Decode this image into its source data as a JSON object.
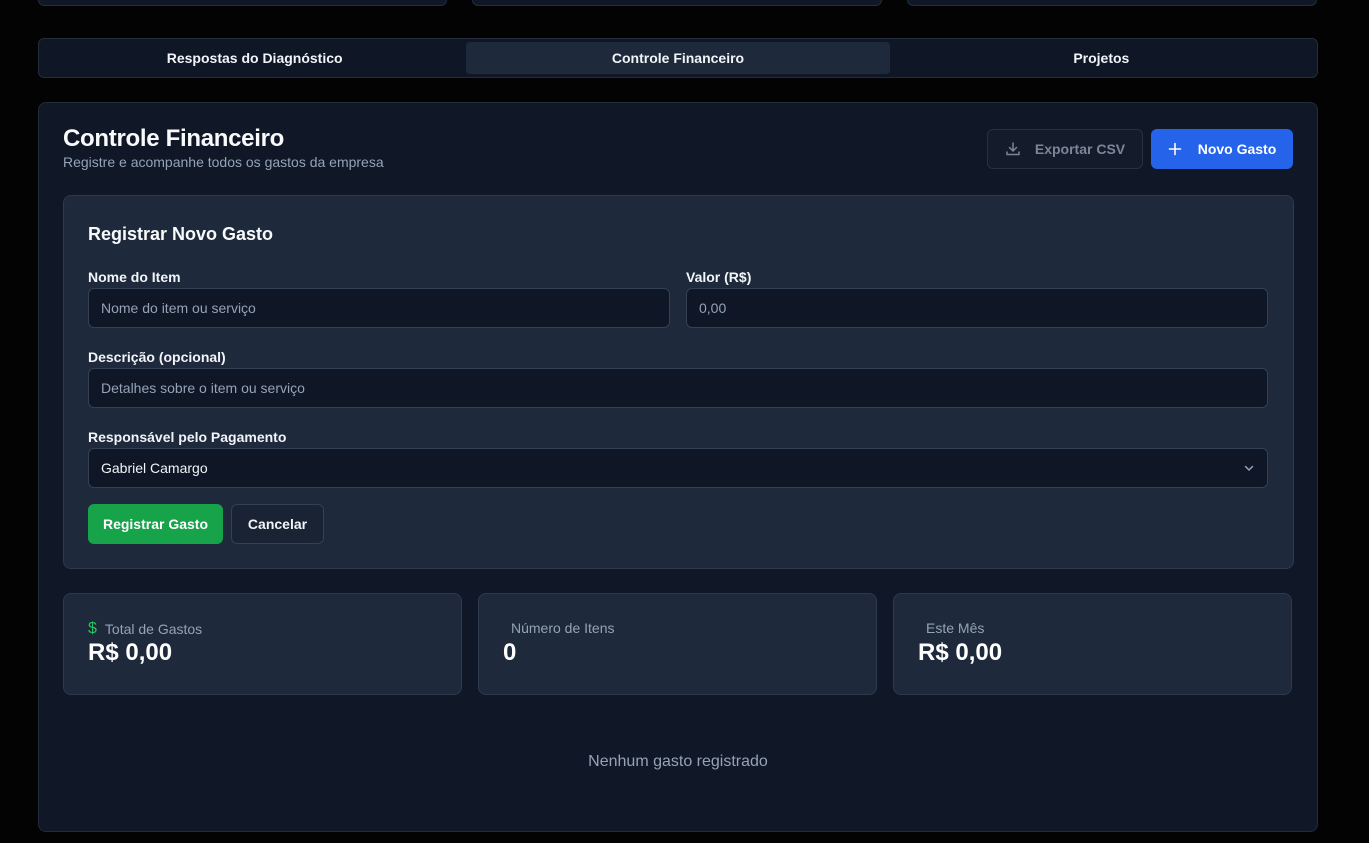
{
  "tabs": [
    {
      "label": "Respostas do Diagnóstico",
      "active": false
    },
    {
      "label": "Controle Financeiro",
      "active": true
    },
    {
      "label": "Projetos",
      "active": false
    }
  ],
  "header": {
    "title": "Controle Financeiro",
    "subtitle": "Registre e acompanhe todos os gastos da empresa",
    "export_label": "Exportar CSV",
    "export_icon": "download-icon",
    "new_label": "Novo Gasto",
    "new_icon": "plus-icon"
  },
  "form": {
    "title": "Registrar Novo Gasto",
    "name_label": "Nome do Item",
    "name_placeholder": "Nome do item ou serviço",
    "name_value": "",
    "value_label": "Valor (R$)",
    "value_placeholder": "0,00",
    "value_value": "",
    "desc_label": "Descrição (opcional)",
    "desc_placeholder": "Detalhes sobre o item ou serviço",
    "desc_value": "",
    "payer_label": "Responsável pelo Pagamento",
    "payer_selected": "Gabriel Camargo",
    "submit_label": "Registrar Gasto",
    "cancel_label": "Cancelar"
  },
  "stats": {
    "total_label": "Total de Gastos",
    "total_value": "R$ 0,00",
    "total_icon": "dollar-icon",
    "count_label": "Número de Itens",
    "count_value": "0",
    "month_label": "Este Mês",
    "month_value": "R$ 0,00"
  },
  "empty_message": "Nenhum gasto registrado",
  "colors": {
    "background": "#030303",
    "panel": "#101726",
    "card": "#1e293b",
    "primary": "#2563eb",
    "success": "#16a34a",
    "dollar": "#22c55e"
  }
}
